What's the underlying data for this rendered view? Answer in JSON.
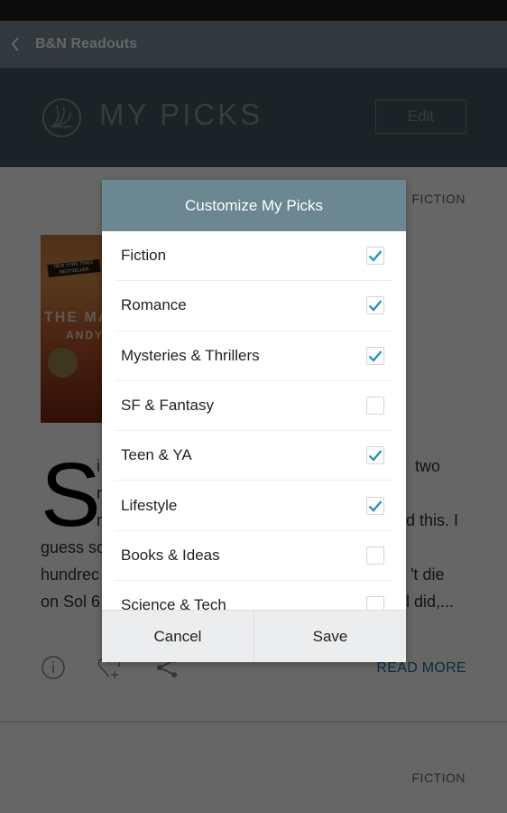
{
  "app_bar": {
    "title": "B&N Readouts",
    "back_icon": "chevron-left-icon"
  },
  "hero": {
    "logo_icon": "readouts-logo-icon",
    "title": "MY PICKS",
    "edit_label": "Edit"
  },
  "card": {
    "category": "FICTION",
    "cover": {
      "title": "THE MA",
      "author": "ANDY",
      "badge": "NEW YORK TIMES BESTSELLER"
    },
    "excerpt": {
      "dropcap": "S",
      "lines": [
        "two",
        "d this. I",
        "guess so",
        "'t die",
        "hundrec",
        "on Sol 6",
        "l did,..."
      ],
      "line_1_prefix": "i",
      "line_2_prefix": "n",
      "line_3_prefix": "n"
    },
    "actions": {
      "info_icon": "info-icon",
      "favorite_icon": "heart-add-icon",
      "share_icon": "share-icon",
      "read_more_label": "READ MORE"
    }
  },
  "next_card": {
    "category": "FICTION"
  },
  "dialog": {
    "title": "Customize My Picks",
    "items": [
      {
        "label": "Fiction",
        "checked": true
      },
      {
        "label": "Romance",
        "checked": true
      },
      {
        "label": "Mysteries & Thrillers",
        "checked": true
      },
      {
        "label": "SF & Fantasy",
        "checked": false
      },
      {
        "label": "Teen & YA",
        "checked": true
      },
      {
        "label": "Lifestyle",
        "checked": true
      },
      {
        "label": "Books & Ideas",
        "checked": false
      },
      {
        "label": "Science & Tech",
        "checked": false
      }
    ],
    "cancel_label": "Cancel",
    "save_label": "Save"
  },
  "colors": {
    "accent": "#1a8fb5",
    "dialog_header": "#6a8792",
    "read_more": "#1a6d8c"
  }
}
